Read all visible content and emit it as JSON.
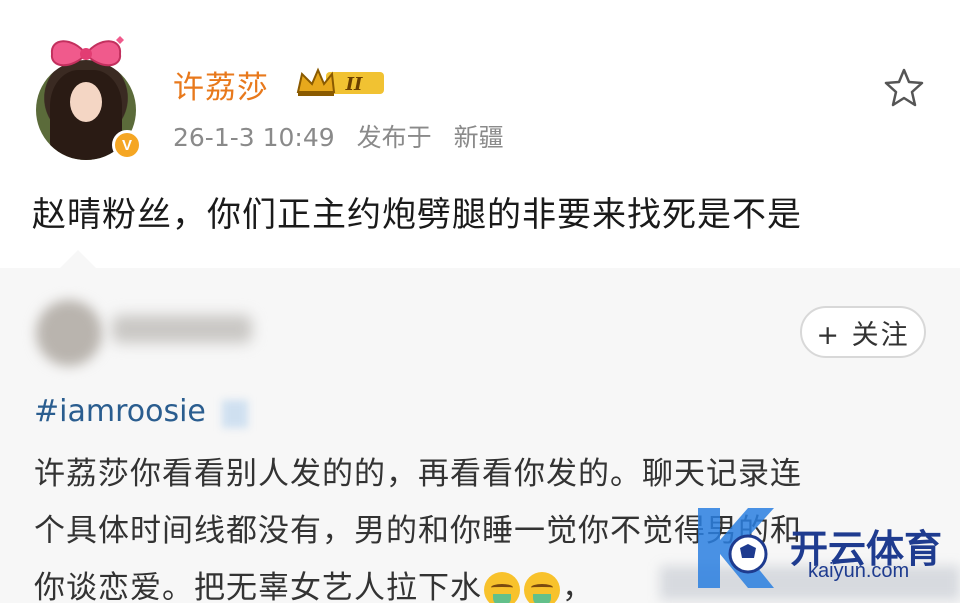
{
  "post": {
    "username": "许荔莎",
    "level_badge": "II",
    "timestamp": "26-1-3 10:49",
    "published_label": "发布于",
    "location": "新疆",
    "text": "赵晴粉丝，你们正主约炮劈腿的非要来找死是不是",
    "verified_badge": "V"
  },
  "repost": {
    "follow_label": "+ 关注",
    "hashtag": "#iamroosie",
    "line1": "许荔莎你看看别人发的的，再看看你发的。聊天记录连",
    "line2": "个具体时间线都没有，男的和你睡一觉你不觉得男的和",
    "line3_a": "你谈恋爱。把无辜女艺人拉下水",
    "line3_b": "，"
  },
  "watermark": {
    "title": "开云体育",
    "url": "kaiyun.com"
  },
  "colors": {
    "username": "#e8791c",
    "hashtag": "#2a5d8f",
    "verified": "#f5a623",
    "watermark": "#1e3b8f"
  }
}
